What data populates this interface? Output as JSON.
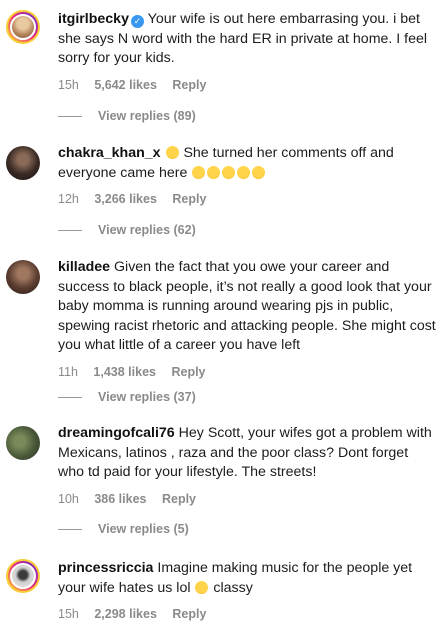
{
  "comments": [
    {
      "username": "itgirlbecky",
      "verified": true,
      "text": "Your wife is out here embarrasing you. i bet she says N word with the hard ER in private at home. I feel sorry for your kids.",
      "time": "15h",
      "likes": "5,642 likes",
      "reply": "Reply",
      "view_replies": "View replies (89)",
      "emoji_count": 0
    },
    {
      "username": "chakra_khan_x",
      "verified": false,
      "text": "She turned her comments off and everyone came here",
      "time": "12h",
      "likes": "3,266 likes",
      "reply": "Reply",
      "view_replies": "View replies (62)",
      "emoji_count": 6
    },
    {
      "username": "killadee",
      "verified": false,
      "text": "Given the fact that you owe your career and success to black people, it’s not really a good look that your baby momma is running around wearing pjs in public, spewing racist rhetoric and attacking people. She might cost you what little of a career you have left",
      "time": "11h",
      "likes": "1,438 likes",
      "reply": "Reply",
      "view_replies": "View replies (37)",
      "emoji_count": 0
    },
    {
      "username": "dreamingofcali76",
      "verified": false,
      "text": "Hey Scott, your wifes got a problem with Mexicans, latinos , raza and the poor class? Dont forget who td paid for your lifestyle. The streets!",
      "time": "10h",
      "likes": "386 likes",
      "reply": "Reply",
      "view_replies": "View replies (5)",
      "emoji_count": 0
    },
    {
      "username": "princessriccia",
      "verified": false,
      "text": "Imagine making music for the people yet your wife hates us lol",
      "text_tail": "classy",
      "time": "15h",
      "likes": "2,298 likes",
      "reply": "Reply",
      "emoji_count": 1
    }
  ]
}
